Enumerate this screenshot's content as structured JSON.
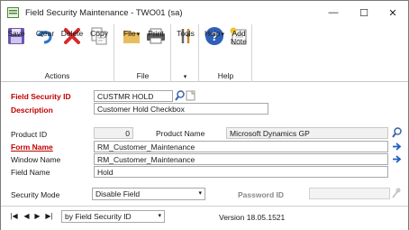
{
  "window": {
    "title": "Field Security Maintenance  -  TWO01 (sa)",
    "controls": {
      "minimize": "—",
      "maximize": "☐",
      "close": "✕"
    }
  },
  "ribbon": {
    "actions_group": "Actions",
    "file_group": "File",
    "help_group": "Help",
    "buttons": {
      "save": "Save",
      "clear": "Clear",
      "delete": "Delete",
      "copy": "Copy",
      "file": "File",
      "print": "Print",
      "tools": "Tools",
      "help": "Help",
      "add_note_line1": "Add",
      "add_note_line2": "Note"
    },
    "icons": {
      "save": "floppy-disk-icon",
      "clear": "undo-arrow-icon",
      "delete": "red-x-icon",
      "copy": "copy-pages-icon",
      "file": "folder-icon",
      "print": "printer-icon",
      "tools": "tools-icon",
      "help": "question-icon",
      "add_note": "note-icon"
    }
  },
  "form": {
    "field_security_id": {
      "label": "Field Security ID",
      "value": "CUSTMR HOLD"
    },
    "description": {
      "label": "Description",
      "value": "Customer Hold Checkbox"
    },
    "product_id": {
      "label": "Product ID",
      "value": "0"
    },
    "product_name": {
      "label": "Product Name",
      "value": "Microsoft Dynamics GP"
    },
    "form_name": {
      "label": "Form Name",
      "value": "RM_Customer_Maintenance"
    },
    "window_name": {
      "label": "Window Name",
      "value": "RM_Customer_Maintenance"
    },
    "field_name": {
      "label": "Field Name",
      "value": "Hold"
    },
    "security_mode": {
      "label": "Security Mode",
      "value": "Disable Field"
    },
    "password_id": {
      "label": "Password ID",
      "value": ""
    }
  },
  "statusbar": {
    "nav": {
      "first": "|◀",
      "prev": "◀",
      "next": "▶",
      "last": "▶|"
    },
    "sort": "by Field Security ID",
    "version": "Version 18.05.1521"
  },
  "colors": {
    "required_label": "#c00000",
    "link_arrow": "#1f5fbf"
  }
}
